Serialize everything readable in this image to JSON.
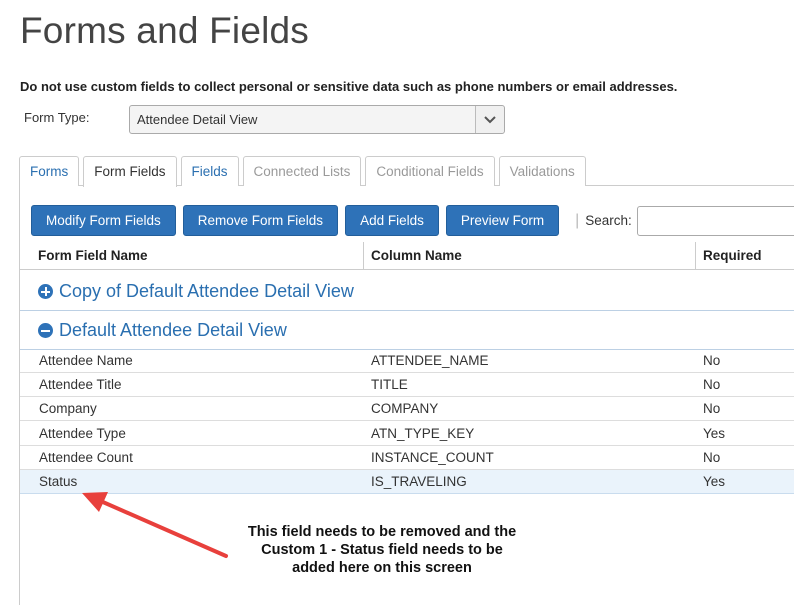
{
  "page": {
    "title": "Forms and Fields",
    "warning": "Do not use custom fields to collect personal or sensitive data such as phone numbers or email addresses."
  },
  "form_type": {
    "label": "Form Type:",
    "selected": "Attendee Detail View",
    "icon": "chevron-down-icon"
  },
  "tabs": [
    {
      "label": "Forms",
      "state": "link"
    },
    {
      "label": "Form Fields",
      "state": "active"
    },
    {
      "label": "Fields",
      "state": "link"
    },
    {
      "label": "Connected Lists",
      "state": "disabled"
    },
    {
      "label": "Conditional Fields",
      "state": "disabled"
    },
    {
      "label": "Validations",
      "state": "disabled"
    }
  ],
  "toolbar": {
    "modify_label": "Modify Form Fields",
    "remove_label": "Remove Form Fields",
    "add_label": "Add Fields",
    "preview_label": "Preview Form",
    "separator": "|",
    "search_label": "Search:",
    "search_value": ""
  },
  "table": {
    "headers": [
      "Form Field Name",
      "Column Name",
      "Required"
    ],
    "groups": [
      {
        "label": "Copy of Default Attendee Detail View",
        "icon": "plus-circle-icon",
        "expanded": false
      },
      {
        "label": "Default Attendee Detail View",
        "icon": "minus-circle-icon",
        "expanded": true
      }
    ],
    "rows": [
      {
        "name": "Attendee Name",
        "column": "ATTENDEE_NAME",
        "required": "No"
      },
      {
        "name": "Attendee Title",
        "column": "TITLE",
        "required": "No"
      },
      {
        "name": "Company",
        "column": "COMPANY",
        "required": "No"
      },
      {
        "name": "Attendee Type",
        "column": "ATN_TYPE_KEY",
        "required": "Yes"
      },
      {
        "name": "Attendee Count",
        "column": "INSTANCE_COUNT",
        "required": "No"
      },
      {
        "name": "Status",
        "column": "IS_TRAVELING",
        "required": "Yes"
      }
    ]
  },
  "annotation": {
    "line1": "This field needs to be removed and the",
    "line2": "Custom 1 - Status field needs to be",
    "line3": "added here on this screen",
    "arrow_color": "#e8403c"
  },
  "colors": {
    "accent": "#2e72b8",
    "link": "#2a6fb0",
    "highlight_row": "#eaf3fb"
  }
}
